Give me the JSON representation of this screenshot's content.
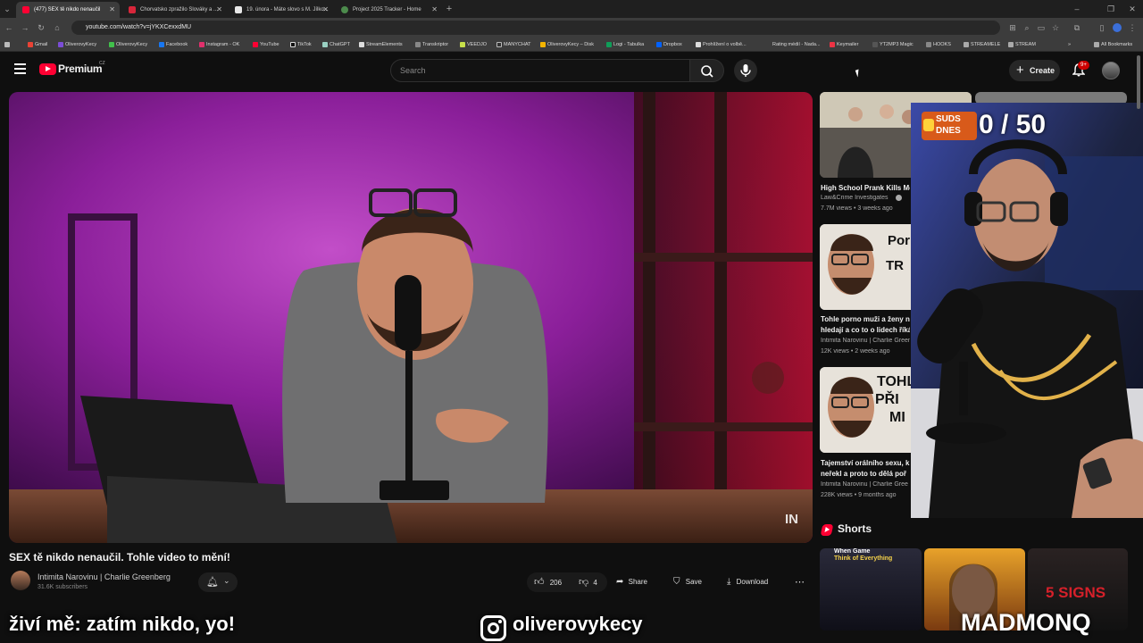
{
  "browser": {
    "tabs": [
      {
        "title": "(477) SEX tě nikdo nenaučil",
        "fav_color": "#ff0033"
      },
      {
        "title": "Chorvatsko zpražilo Slováky a ...",
        "fav_color": "#d8263a"
      },
      {
        "title": "19. února - Máte slovo s M. Jílko...",
        "fav_color": "#e8e8e8"
      },
      {
        "title": "Project 2025 Tracker - Home",
        "fav_color": "#4c8b4c"
      }
    ],
    "url": "youtube.com/watch?v=jYKXCexxdMU",
    "bookmarks": [
      "Gmail",
      "OliverovyKecy",
      "OliverovyKecy",
      "Facebook",
      "Instagram - OK",
      "YouTube",
      "TikTok",
      "ChatGPT",
      "StreamElements",
      "Transkriptor",
      "VEEDJO",
      "MANYCHAT",
      "OliverovyKecy – Disk",
      "Logi - Tabulka",
      "Dropbox",
      "Prohlížení o volbě...",
      "Rating médií - Nada...",
      "Keymailer",
      "YT2MP3 Magic",
      "HOOKS",
      "STREAMELE",
      "STREAM"
    ],
    "all_bookmarks": "All Bookmarks"
  },
  "yt": {
    "logo_text": "Premium",
    "logo_sup": "CZ",
    "search_placeholder": "Search",
    "create_label": "Create",
    "notif_badge": "9+"
  },
  "video": {
    "watermark": "IN",
    "title": "SEX tě nikdo nenaučil. Tohle video to mění!",
    "channel": "Intimita Narovinu | Charlie Greenberg",
    "subscribers": "31.6K subscribers",
    "likes": "206",
    "dislikes": "4",
    "share": "Share",
    "save": "Save",
    "download": "Download"
  },
  "sidebar": {
    "recs": [
      {
        "title": "High School Prank Kills Mo",
        "channel": "Law&Crime Investigates",
        "meta": "7.7M views • 3 weeks ago"
      },
      {
        "title": "Tohle porno muži a ženy n",
        "title2": "hledají a co to o lidech říká",
        "channel": "Intimita Narovinu | Charlie Green",
        "meta": "12K views • 2 weeks ago",
        "thumb_text1": "Por",
        "thumb_text2": "TR"
      },
      {
        "title": "Tajemství orálního sexu, k",
        "title2": "neřekl a proto to dělá poř",
        "channel": "Intimita Narovinu | Charlie Gree",
        "meta": "228K views • 9 months ago",
        "thumb_text1": "TOHL",
        "thumb_text2": "PŘI",
        "thumb_text3": "MI"
      }
    ],
    "shorts_label": "Shorts",
    "shorts": [
      {
        "caption1": "When Game",
        "caption2": "Think of Everything"
      },
      {
        "caption1": ""
      },
      {
        "caption1": "5 SIGNS"
      }
    ]
  },
  "webcam": {
    "counter": "0 / 50",
    "badge_line1": "SUDS",
    "badge_line2": "DNES"
  },
  "overlay": {
    "left_text": "živí mě: zatím nikdo, yo!",
    "mid_text": "oliverovykecy",
    "right_text": "MADMONQ"
  }
}
